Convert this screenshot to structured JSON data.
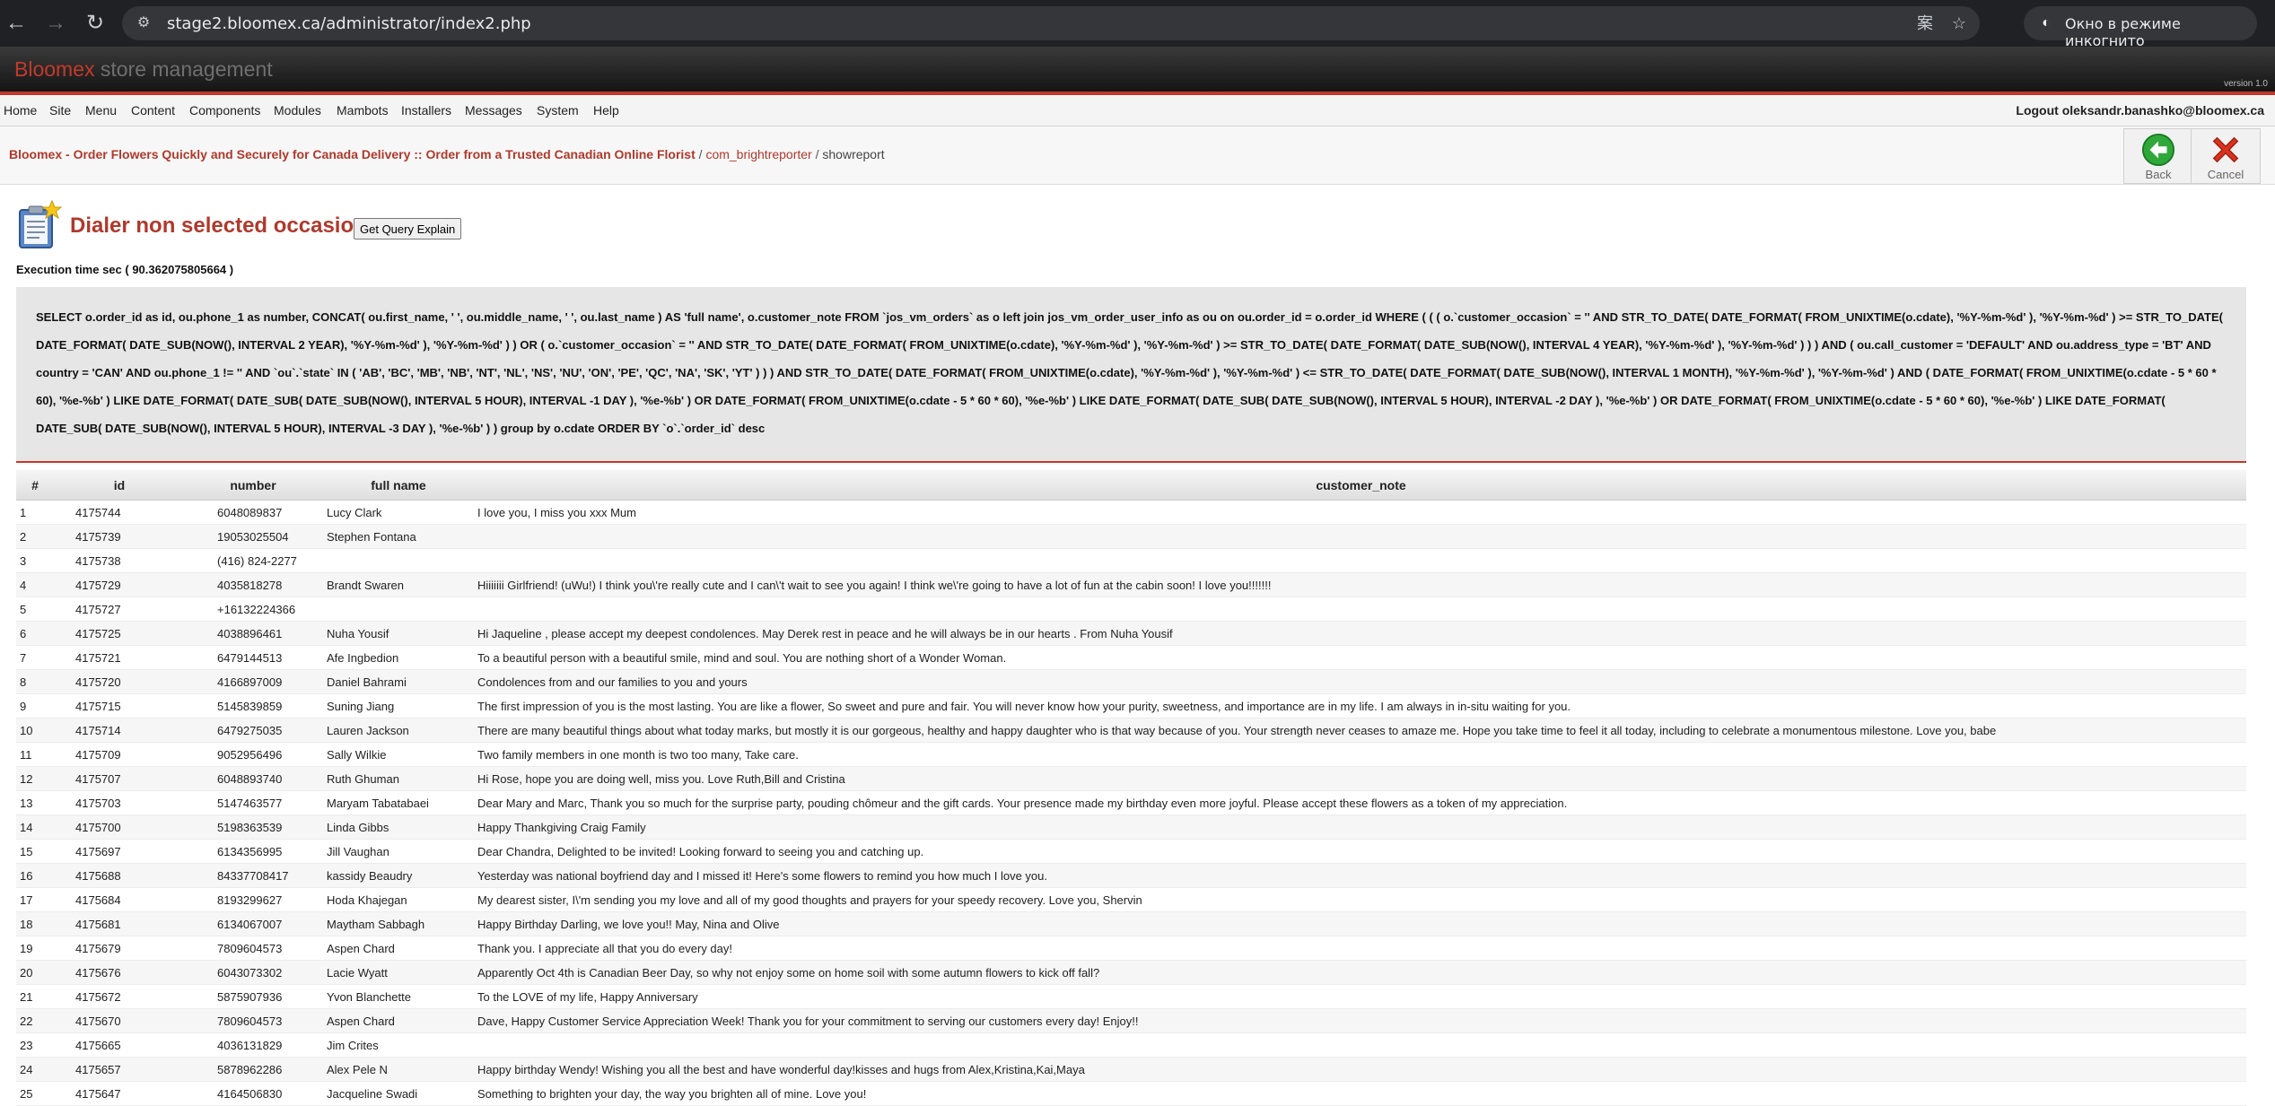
{
  "browser": {
    "url": "stage2.bloomex.ca/administrator/index2.php",
    "incognito_label": "Окно в режиме инкогнито"
  },
  "header": {
    "brand_main": "Bloomex",
    "brand_sub": " store management",
    "version": "version 1.0"
  },
  "menu": {
    "items": [
      "Home",
      "Site",
      "Menu",
      "Content",
      "Components",
      "Modules",
      "Mambots",
      "Installers",
      "Messages",
      "System",
      "Help"
    ],
    "logout": "Logout oleksandr.banashko@bloomex.ca"
  },
  "breadcrumb": {
    "site": "Bloomex - Order Flowers Quickly and Securely for Canada Delivery :: Order from a Trusted Canadian Online Florist",
    "sep1": " / ",
    "component": "com_brightreporter",
    "sep2": " / ",
    "current": "showreport"
  },
  "toolbar": {
    "back_label": "Back",
    "cancel_label": "Cancel"
  },
  "report": {
    "title": "Dialer non selected occasion",
    "explain_button": "Get Query Explain",
    "execution_time": "Execution time sec ( 90.362075805664 )",
    "sql": "SELECT o.order_id as id, ou.phone_1 as number, CONCAT( ou.first_name, ' ', ou.middle_name, ' ', ou.last_name ) AS 'full name', o.customer_note FROM `jos_vm_orders` as o left join jos_vm_order_user_info as ou on ou.order_id = o.order_id WHERE ( ( ( o.`customer_occasion` = '' AND STR_TO_DATE( DATE_FORMAT( FROM_UNIXTIME(o.cdate), '%Y-%m-%d' ), '%Y-%m-%d' ) >= STR_TO_DATE( DATE_FORMAT( DATE_SUB(NOW(), INTERVAL 2 YEAR), '%Y-%m-%d' ), '%Y-%m-%d' ) ) OR ( o.`customer_occasion` = '' AND STR_TO_DATE( DATE_FORMAT( FROM_UNIXTIME(o.cdate), '%Y-%m-%d' ), '%Y-%m-%d' ) >= STR_TO_DATE( DATE_FORMAT( DATE_SUB(NOW(), INTERVAL 4 YEAR), '%Y-%m-%d' ), '%Y-%m-%d' ) ) ) AND ( ou.call_customer = 'DEFAULT' AND ou.address_type = 'BT' AND country = 'CAN' AND ou.phone_1 != '' AND `ou`.`state` IN ( 'AB', 'BC', 'MB', 'NB', 'NT', 'NL', 'NS', 'NU', 'ON', 'PE', 'QC', 'NA', 'SK', 'YT' ) ) ) AND STR_TO_DATE( DATE_FORMAT( FROM_UNIXTIME(o.cdate), '%Y-%m-%d' ), '%Y-%m-%d' ) <= STR_TO_DATE( DATE_FORMAT( DATE_SUB(NOW(), INTERVAL 1 MONTH), '%Y-%m-%d' ), '%Y-%m-%d' ) AND ( DATE_FORMAT( FROM_UNIXTIME(o.cdate - 5 * 60 * 60), '%e-%b' ) LIKE DATE_FORMAT( DATE_SUB( DATE_SUB(NOW(), INTERVAL 5 HOUR), INTERVAL -1 DAY ), '%e-%b' ) OR DATE_FORMAT( FROM_UNIXTIME(o.cdate - 5 * 60 * 60), '%e-%b' ) LIKE DATE_FORMAT( DATE_SUB( DATE_SUB(NOW(), INTERVAL 5 HOUR), INTERVAL -2 DAY ), '%e-%b' ) OR DATE_FORMAT( FROM_UNIXTIME(o.cdate - 5 * 60 * 60), '%e-%b' ) LIKE DATE_FORMAT( DATE_SUB( DATE_SUB(NOW(), INTERVAL 5 HOUR), INTERVAL -3 DAY ), '%e-%b' ) ) group by o.cdate ORDER BY `o`.`order_id` desc"
  },
  "table": {
    "columns": [
      "#",
      "id",
      "number",
      "full name",
      "customer_note"
    ],
    "rows": [
      [
        "1",
        "4175744",
        "6048089837",
        "Lucy Clark",
        "I love you, I miss you xxx Mum"
      ],
      [
        "2",
        "4175739",
        "19053025504",
        "Stephen Fontana",
        ""
      ],
      [
        "3",
        "4175738",
        "(416) 824-2277",
        "",
        ""
      ],
      [
        "4",
        "4175729",
        "4035818278",
        "Brandt Swaren",
        "Hiiiiiii Girlfriend! (uWu!) I think you\\'re really cute and I can\\'t wait to see you again! I think we\\'re going to have a lot of fun at the cabin soon! I love you!!!!!!!"
      ],
      [
        "5",
        "4175727",
        "+16132224366",
        "",
        ""
      ],
      [
        "6",
        "4175725",
        "4038896461",
        "Nuha Yousif",
        "Hi Jaqueline , please accept my deepest condolences. May Derek rest in peace and he will always be in our hearts . From Nuha Yousif"
      ],
      [
        "7",
        "4175721",
        "6479144513",
        "Afe Ingbedion",
        "To a beautiful person with a beautiful smile, mind and soul. You are nothing short of a Wonder Woman."
      ],
      [
        "8",
        "4175720",
        "4166897009",
        "Daniel Bahrami",
        "Condolences from and our families to you and yours"
      ],
      [
        "9",
        "4175715",
        "5145839859",
        "Suning Jiang",
        "The first impression of you is the most lasting. You are like a flower, So sweet and pure and fair. You will never know how your purity, sweetness, and importance are in my life. I am always in in-situ waiting for you."
      ],
      [
        "10",
        "4175714",
        "6479275035",
        "Lauren Jackson",
        "There are many beautiful things about what today marks, but mostly it is our gorgeous, healthy and happy daughter who is that way because of you. Your strength never ceases to amaze me. Hope you take time to feel it all today, including to celebrate a monumentous milestone. Love you, babe"
      ],
      [
        "11",
        "4175709",
        "9052956496",
        "Sally Wilkie",
        "Two family members in one month is two too many, Take care."
      ],
      [
        "12",
        "4175707",
        "6048893740",
        "Ruth Ghuman",
        "Hi Rose, hope you are doing well, miss you. Love Ruth,Bill and Cristina"
      ],
      [
        "13",
        "4175703",
        "5147463577",
        "Maryam Tabatabaei",
        "Dear Mary and Marc, Thank you so much for the surprise party, pouding chômeur and the gift cards. Your presence made my birthday even more joyful. Please accept these flowers as a token of my appreciation."
      ],
      [
        "14",
        "4175700",
        "5198363539",
        "Linda Gibbs",
        "Happy Thankgiving Craig Family"
      ],
      [
        "15",
        "4175697",
        "6134356995",
        "Jill Vaughan",
        "Dear Chandra, Delighted to be invited! Looking forward to seeing you and catching up."
      ],
      [
        "16",
        "4175688",
        "84337708417",
        "kassidy Beaudry",
        "Yesterday was national boyfriend day and I missed it! Here's some flowers to remind you how much I love you."
      ],
      [
        "17",
        "4175684",
        "8193299627",
        "Hoda Khajegan",
        "My dearest sister, I\\'m sending you my love and all of my good thoughts and prayers for your speedy recovery. Love you, Shervin"
      ],
      [
        "18",
        "4175681",
        "6134067007",
        "Maytham Sabbagh",
        "Happy Birthday Darling, we love you!! May, Nina and Olive"
      ],
      [
        "19",
        "4175679",
        "7809604573",
        "Aspen Chard",
        "Thank you. I appreciate all that you do every day!"
      ],
      [
        "20",
        "4175676",
        "6043073302",
        "Lacie Wyatt",
        "Apparently Oct 4th is Canadian Beer Day, so why not enjoy some on home soil with some autumn flowers to kick off fall?"
      ],
      [
        "21",
        "4175672",
        "5875907936",
        "Yvon Blanchette",
        "To the LOVE of my life, Happy Anniversary"
      ],
      [
        "22",
        "4175670",
        "7809604573",
        "Aspen Chard",
        "Dave, Happy Customer Service Appreciation Week! Thank you for your commitment to serving our customers every day! Enjoy!!"
      ],
      [
        "23",
        "4175665",
        "4036131829",
        "Jim Crites",
        ""
      ],
      [
        "24",
        "4175657",
        "5878962286",
        "Alex Pele N",
        "Happy birthday Wendy! Wishing you all the best and have wonderful day!kisses and hugs from Alex,Kristina,Kai,Maya"
      ],
      [
        "25",
        "4175647",
        "4164506830",
        "Jacqueline Swadi",
        "Something to brighten your day, the way you brighten all of mine. Love you!"
      ]
    ]
  }
}
